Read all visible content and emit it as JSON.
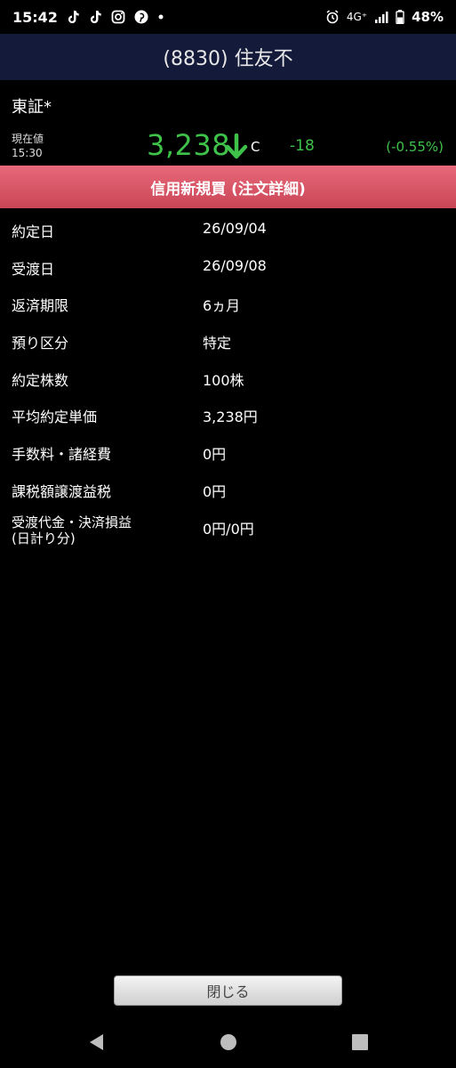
{
  "status_bar": {
    "time": "15:42",
    "notification_icons": [
      "tiktok-icon",
      "tiktok-icon",
      "instagram-icon",
      "pinterest-icon",
      "dot-icon"
    ],
    "network": "4G⁺",
    "battery": "48%"
  },
  "header": {
    "title": "(8830) 住友不"
  },
  "quote": {
    "exchange": "東証*",
    "caption_label": "現在値",
    "caption_time": "15:30",
    "price": "3,238",
    "direction": "down",
    "flag": "C",
    "change": "-18",
    "change_pct": "(-0.55%)",
    "color_down": "#3ec24a"
  },
  "banner": {
    "text": "信用新規買 (注文詳細)",
    "color": "#d95566"
  },
  "details": [
    {
      "label": "約定日",
      "value": "26/09/04"
    },
    {
      "label": "受渡日",
      "value": "26/09/08"
    },
    {
      "label": "返済期限",
      "value": "6ヵ月"
    },
    {
      "label": "預り区分",
      "value": "特定"
    },
    {
      "label": "約定株数",
      "value": "100株"
    },
    {
      "label": "平均約定単価",
      "value": "3,238円"
    },
    {
      "label": "手数料・諸経費",
      "value": "0円"
    },
    {
      "label": "課税額譲渡益税",
      "value": "0円"
    },
    {
      "label_line1": "受渡代金・決済損益",
      "label_line2": "(日計り分)",
      "value": "0円/0円"
    }
  ],
  "footer": {
    "close_label": "閉じる"
  },
  "nav": {
    "icons": [
      "back-icon",
      "home-icon",
      "recents-icon"
    ]
  }
}
